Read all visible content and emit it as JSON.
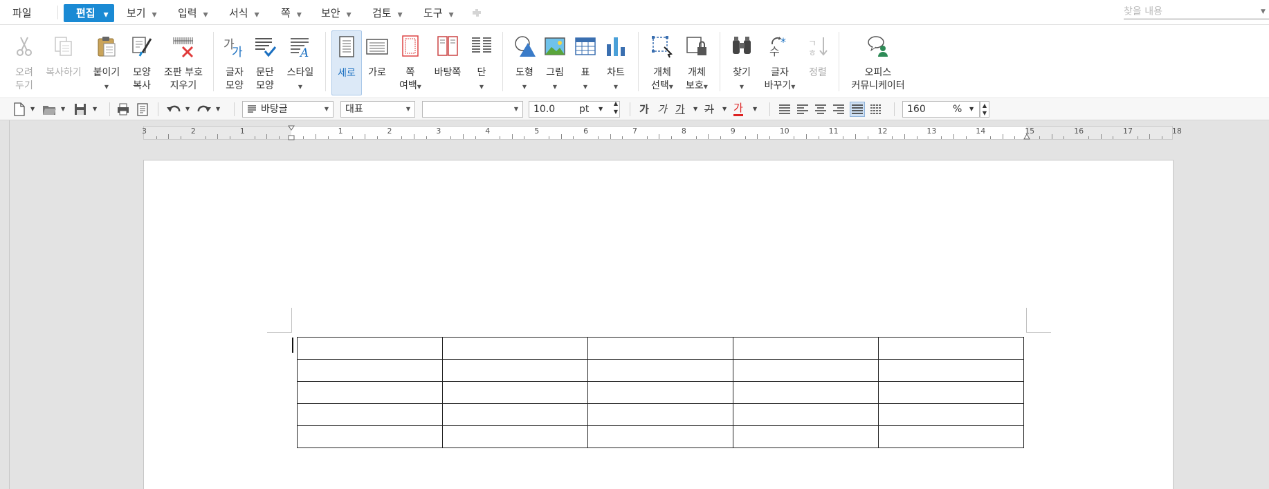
{
  "menubar": {
    "items": [
      "파일",
      "편집",
      "보기",
      "입력",
      "서식",
      "쪽",
      "보안",
      "검토",
      "도구"
    ],
    "active": "편집",
    "search_placeholder": "찾을 내용"
  },
  "ribbon": {
    "cut": "오려\n두기",
    "copy": "복사하기",
    "paste": "붙이기",
    "format_copy": "모양\n복사",
    "clear_marks": "조판 부호\n지우기",
    "char_shape": "글자\n모양",
    "para_shape": "문단\n모양",
    "style": "스타일",
    "portrait": "세로",
    "landscape": "가로",
    "page_margin": "쪽\n여백",
    "master_page": "바탕쪽",
    "columns": "단",
    "shape": "도형",
    "picture": "그림",
    "table": "표",
    "chart": "차트",
    "object_select": "개체\n선택",
    "object_protect": "개체\n보호",
    "find": "찾기",
    "replace": "글자\n바꾸기",
    "sort": "정렬",
    "office_communicator": "오피스\n커뮤니케이터"
  },
  "format_toolbar": {
    "style_value": "바탕글",
    "font_lang": "대표",
    "font_name": "",
    "font_size": "10.0",
    "size_unit": "pt",
    "bold": "가",
    "italic": "가",
    "underline": "가",
    "strike": "가",
    "font_color": "가",
    "zoom_value": "160",
    "zoom_unit": "%"
  },
  "ruler": {
    "ticks": [
      "3",
      "2",
      "1",
      "",
      "1",
      "2",
      "3",
      "4",
      "5",
      "6",
      "7",
      "8",
      "9",
      "10",
      "11",
      "12",
      "13",
      "14",
      "15",
      "16",
      "17",
      "18"
    ]
  },
  "document": {
    "table_rows": 5,
    "table_cols": 5
  },
  "colors": {
    "accent": "#1a8ad4",
    "selected_bg": "#dce9f7",
    "workspace": "#e3e3e3"
  }
}
